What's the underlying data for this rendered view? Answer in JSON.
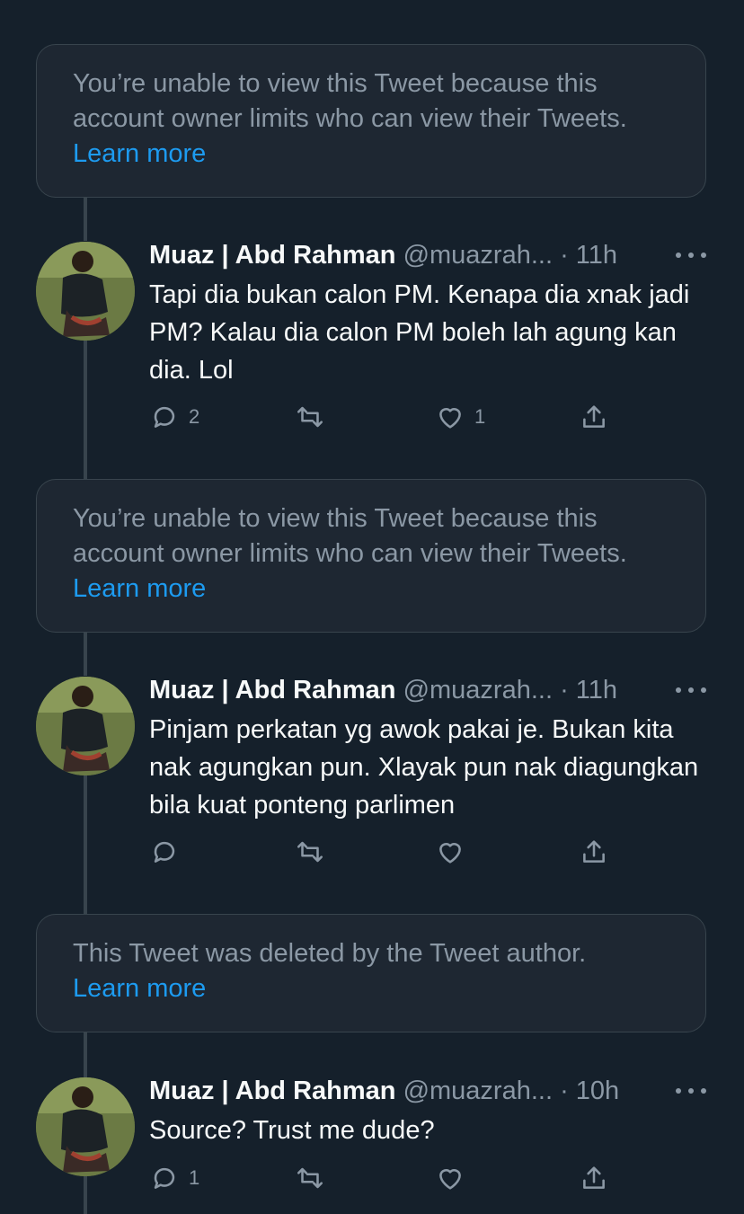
{
  "notices": [
    {
      "text": "You’re unable to view this Tweet because this account owner limits who can view their Tweets.",
      "link": "Learn more"
    },
    {
      "text": "You’re unable to view this Tweet because this account owner limits who can view their Tweets.",
      "link": "Learn more"
    },
    {
      "text": "This Tweet was deleted by the Tweet author.",
      "link": "Learn more"
    }
  ],
  "tweets": [
    {
      "name": "Muaz | Abd Rahman",
      "handle": "@muazrah...",
      "time": "· 11h",
      "text": "Tapi dia bukan calon PM. Kenapa dia xnak jadi PM? Kalau dia calon PM boleh lah agung kan dia. Lol",
      "replies": "2",
      "retweets": "",
      "likes": "1"
    },
    {
      "name": "Muaz | Abd Rahman",
      "handle": "@muazrah...",
      "time": "· 11h",
      "text": "Pinjam perkatan yg awok pakai je. Bukan kita nak agungkan pun. Xlayak pun nak diagungkan bila kuat ponteng parlimen",
      "replies": "",
      "retweets": "",
      "likes": ""
    },
    {
      "name": "Muaz | Abd Rahman",
      "handle": "@muazrah...",
      "time": "· 10h",
      "text": "Source? Trust me dude?",
      "replies": "1",
      "retweets": "",
      "likes": ""
    }
  ],
  "icons": {
    "reply": "reply-icon",
    "retweet": "retweet-icon",
    "like": "heart-icon",
    "share": "share-icon",
    "more": "more-icon"
  },
  "colors": {
    "background": "#15202b",
    "notice_bg": "#1e2732",
    "border": "#38444d",
    "link": "#1d9bf0",
    "secondary_text": "#8b98a5",
    "primary_text": "#f7f9f9"
  }
}
